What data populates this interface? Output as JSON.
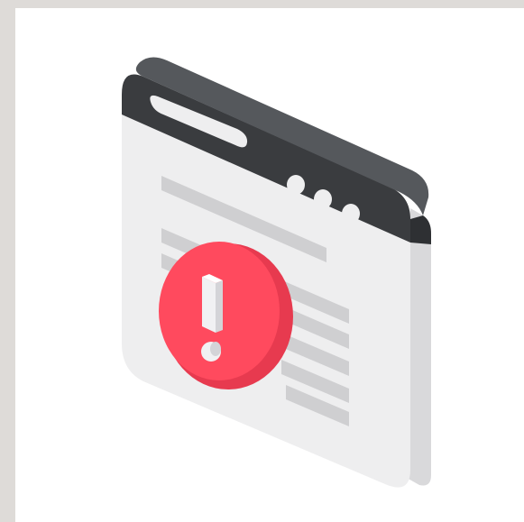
{
  "illustration": {
    "subject": "browser-window-error",
    "icons": {
      "window": "browser-window-icon",
      "alert": "exclamation-alert-icon"
    },
    "colors": {
      "background": "#dedbd8",
      "canvas": "#ffffff",
      "window_face": "#eeeeef",
      "window_side": "#d9d9db",
      "title_bar": "#3a3c3f",
      "title_bar_top": "#55585c",
      "content_lines": "#cfcfd1",
      "alert": "#ff4a5e",
      "alert_side": "#e73a4f",
      "alert_glyph": "#f1f1f3"
    },
    "window_controls_count": 3
  }
}
